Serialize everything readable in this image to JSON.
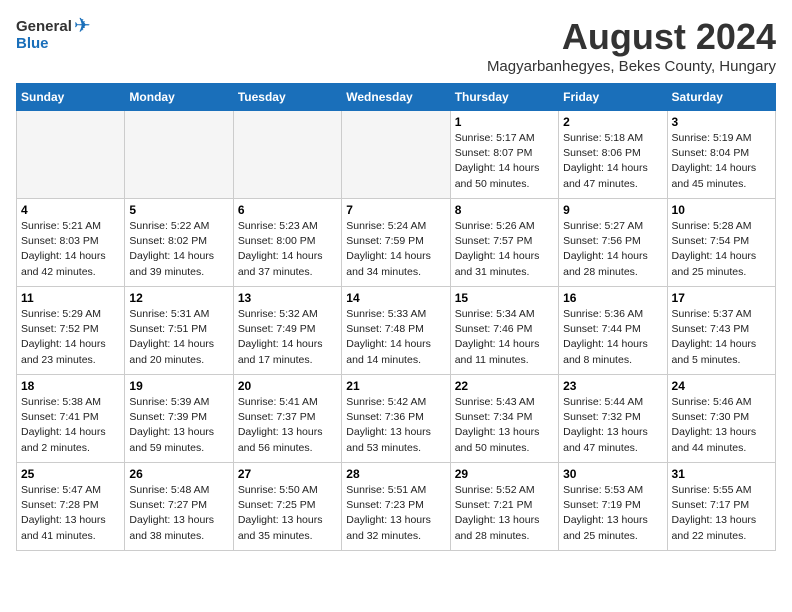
{
  "header": {
    "logo_general": "General",
    "logo_blue": "Blue",
    "month": "August 2024",
    "location": "Magyarbanhegyes, Bekes County, Hungary"
  },
  "days_of_week": [
    "Sunday",
    "Monday",
    "Tuesday",
    "Wednesday",
    "Thursday",
    "Friday",
    "Saturday"
  ],
  "weeks": [
    [
      {
        "day": "",
        "content": ""
      },
      {
        "day": "",
        "content": ""
      },
      {
        "day": "",
        "content": ""
      },
      {
        "day": "",
        "content": ""
      },
      {
        "day": "1",
        "content": "Sunrise: 5:17 AM\nSunset: 8:07 PM\nDaylight: 14 hours\nand 50 minutes."
      },
      {
        "day": "2",
        "content": "Sunrise: 5:18 AM\nSunset: 8:06 PM\nDaylight: 14 hours\nand 47 minutes."
      },
      {
        "day": "3",
        "content": "Sunrise: 5:19 AM\nSunset: 8:04 PM\nDaylight: 14 hours\nand 45 minutes."
      }
    ],
    [
      {
        "day": "4",
        "content": "Sunrise: 5:21 AM\nSunset: 8:03 PM\nDaylight: 14 hours\nand 42 minutes."
      },
      {
        "day": "5",
        "content": "Sunrise: 5:22 AM\nSunset: 8:02 PM\nDaylight: 14 hours\nand 39 minutes."
      },
      {
        "day": "6",
        "content": "Sunrise: 5:23 AM\nSunset: 8:00 PM\nDaylight: 14 hours\nand 37 minutes."
      },
      {
        "day": "7",
        "content": "Sunrise: 5:24 AM\nSunset: 7:59 PM\nDaylight: 14 hours\nand 34 minutes."
      },
      {
        "day": "8",
        "content": "Sunrise: 5:26 AM\nSunset: 7:57 PM\nDaylight: 14 hours\nand 31 minutes."
      },
      {
        "day": "9",
        "content": "Sunrise: 5:27 AM\nSunset: 7:56 PM\nDaylight: 14 hours\nand 28 minutes."
      },
      {
        "day": "10",
        "content": "Sunrise: 5:28 AM\nSunset: 7:54 PM\nDaylight: 14 hours\nand 25 minutes."
      }
    ],
    [
      {
        "day": "11",
        "content": "Sunrise: 5:29 AM\nSunset: 7:52 PM\nDaylight: 14 hours\nand 23 minutes."
      },
      {
        "day": "12",
        "content": "Sunrise: 5:31 AM\nSunset: 7:51 PM\nDaylight: 14 hours\nand 20 minutes."
      },
      {
        "day": "13",
        "content": "Sunrise: 5:32 AM\nSunset: 7:49 PM\nDaylight: 14 hours\nand 17 minutes."
      },
      {
        "day": "14",
        "content": "Sunrise: 5:33 AM\nSunset: 7:48 PM\nDaylight: 14 hours\nand 14 minutes."
      },
      {
        "day": "15",
        "content": "Sunrise: 5:34 AM\nSunset: 7:46 PM\nDaylight: 14 hours\nand 11 minutes."
      },
      {
        "day": "16",
        "content": "Sunrise: 5:36 AM\nSunset: 7:44 PM\nDaylight: 14 hours\nand 8 minutes."
      },
      {
        "day": "17",
        "content": "Sunrise: 5:37 AM\nSunset: 7:43 PM\nDaylight: 14 hours\nand 5 minutes."
      }
    ],
    [
      {
        "day": "18",
        "content": "Sunrise: 5:38 AM\nSunset: 7:41 PM\nDaylight: 14 hours\nand 2 minutes."
      },
      {
        "day": "19",
        "content": "Sunrise: 5:39 AM\nSunset: 7:39 PM\nDaylight: 13 hours\nand 59 minutes."
      },
      {
        "day": "20",
        "content": "Sunrise: 5:41 AM\nSunset: 7:37 PM\nDaylight: 13 hours\nand 56 minutes."
      },
      {
        "day": "21",
        "content": "Sunrise: 5:42 AM\nSunset: 7:36 PM\nDaylight: 13 hours\nand 53 minutes."
      },
      {
        "day": "22",
        "content": "Sunrise: 5:43 AM\nSunset: 7:34 PM\nDaylight: 13 hours\nand 50 minutes."
      },
      {
        "day": "23",
        "content": "Sunrise: 5:44 AM\nSunset: 7:32 PM\nDaylight: 13 hours\nand 47 minutes."
      },
      {
        "day": "24",
        "content": "Sunrise: 5:46 AM\nSunset: 7:30 PM\nDaylight: 13 hours\nand 44 minutes."
      }
    ],
    [
      {
        "day": "25",
        "content": "Sunrise: 5:47 AM\nSunset: 7:28 PM\nDaylight: 13 hours\nand 41 minutes."
      },
      {
        "day": "26",
        "content": "Sunrise: 5:48 AM\nSunset: 7:27 PM\nDaylight: 13 hours\nand 38 minutes."
      },
      {
        "day": "27",
        "content": "Sunrise: 5:50 AM\nSunset: 7:25 PM\nDaylight: 13 hours\nand 35 minutes."
      },
      {
        "day": "28",
        "content": "Sunrise: 5:51 AM\nSunset: 7:23 PM\nDaylight: 13 hours\nand 32 minutes."
      },
      {
        "day": "29",
        "content": "Sunrise: 5:52 AM\nSunset: 7:21 PM\nDaylight: 13 hours\nand 28 minutes."
      },
      {
        "day": "30",
        "content": "Sunrise: 5:53 AM\nSunset: 7:19 PM\nDaylight: 13 hours\nand 25 minutes."
      },
      {
        "day": "31",
        "content": "Sunrise: 5:55 AM\nSunset: 7:17 PM\nDaylight: 13 hours\nand 22 minutes."
      }
    ]
  ]
}
